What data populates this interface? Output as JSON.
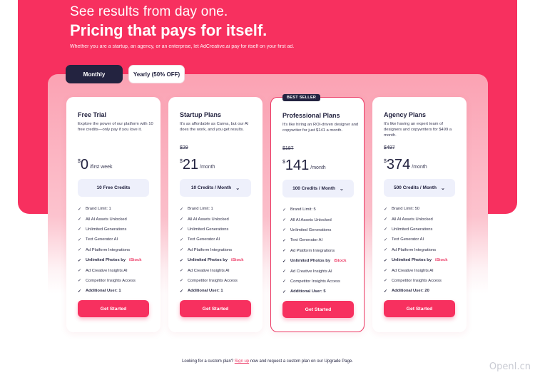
{
  "hero": {
    "eyebrow": "See results from day one.",
    "headline": "Pricing that pays for itself.",
    "subtitle": "Whether you are a startup, an agency, or an enterprise, let AdCreative.ai pay for itself on your first ad."
  },
  "billing_toggle": {
    "monthly_label": "Monthly",
    "yearly_label": "Yearly (50% OFF)",
    "selected": "Monthly"
  },
  "colors": {
    "brand": "#f7305f",
    "dark": "#232340",
    "accent_text": "#ec3b66"
  },
  "plans": [
    {
      "name": "Free Trial",
      "description": "Explore the power of our platform with 10 free credits—only pay if you love it.",
      "old_price": "",
      "currency": "$",
      "amount": "0",
      "period": "/first week",
      "credits": "10 Free Credits",
      "features": [
        "Brand Limit: 1",
        "All AI Assets Unlocked",
        "Unlimited Generations",
        "Text Generator AI",
        "Ad Platform Integrations",
        "Unlimited Photos by",
        "Ad Creative Insights AI",
        "Competitor Insights Access",
        "Additional User: 1"
      ],
      "cta": "Get Started"
    },
    {
      "name": "Startup Plans",
      "description": "It's as affordable as Canva, but our AI does the work, and you get results.",
      "old_price": "$29",
      "currency": "$",
      "amount": "21",
      "period": "/month",
      "credits": "10 Credits / Month",
      "features": [
        "Brand Limit: 1",
        "All AI Assets Unlocked",
        "Unlimited Generations",
        "Text Generator AI",
        "Ad Platform Integrations",
        "Unlimited Photos by",
        "Ad Creative Insights AI",
        "Competitor Insights Access",
        "Additional User: 1"
      ],
      "cta": "Get Started"
    },
    {
      "name": "Professional Plans",
      "badge": "BEST SELLER",
      "description": "It's like hiring an ROI-driven designer and copywriter for just $141 a month.",
      "old_price": "$187",
      "currency": "$",
      "amount": "141",
      "period": "/month",
      "credits": "100 Credits / Month",
      "features": [
        "Brand Limit: 5",
        "All AI Assets Unlocked",
        "Unlimited Generations",
        "Text Generator AI",
        "Ad Platform Integrations",
        "Unlimited Photos by",
        "Ad Creative Insights AI",
        "Competitor Insights Access",
        "Additional User: 5"
      ],
      "cta": "Get Started"
    },
    {
      "name": "Agency Plans",
      "description": "It's like having an expert team of designers and copywriters for $499 a month.",
      "old_price": "$497",
      "currency": "$",
      "amount": "374",
      "period": "/month",
      "credits": "500 Credits / Month",
      "features": [
        "Brand Limit: 50",
        "All AI Assets Unlocked",
        "Unlimited Generations",
        "Text Generator AI",
        "Ad Platform Integrations",
        "Unlimited Photos by",
        "Ad Creative Insights AI",
        "Competitor Insights Access",
        "Additional User: 20"
      ],
      "cta": "Get Started"
    }
  ],
  "istock_label": "iStock",
  "check_glyph": "✓",
  "chevron_glyph": "⌄",
  "footer": {
    "prefix": "Looking for a custom plan?",
    "link": "Sign up",
    "suffix": "now and request a custom plan on our Upgrade Page."
  },
  "watermark": "OpenI.cn"
}
